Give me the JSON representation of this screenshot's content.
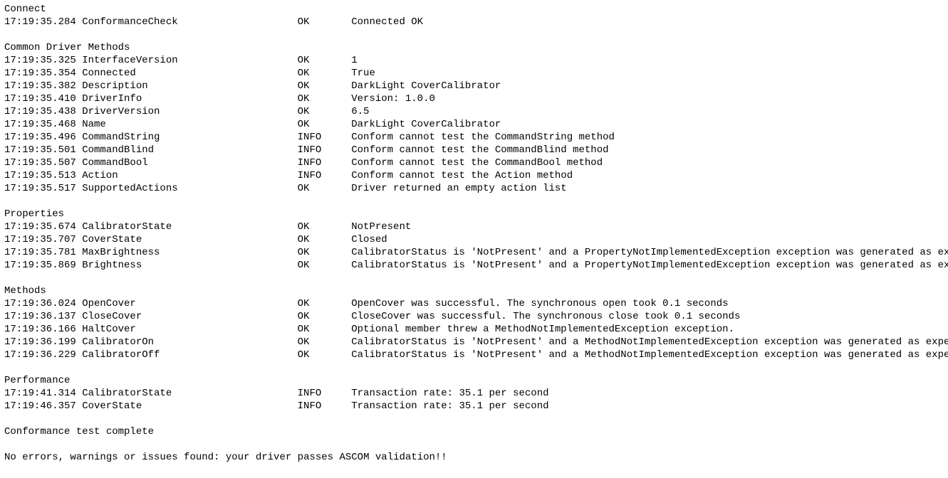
{
  "sections": [
    {
      "title": "Connect",
      "rows": [
        {
          "time": "17:19:35.284",
          "name": "ConformanceCheck",
          "status": "OK",
          "msg": "Connected OK"
        }
      ]
    },
    {
      "title": "Common Driver Methods",
      "rows": [
        {
          "time": "17:19:35.325",
          "name": "InterfaceVersion",
          "status": "OK",
          "msg": "1"
        },
        {
          "time": "17:19:35.354",
          "name": "Connected",
          "status": "OK",
          "msg": "True"
        },
        {
          "time": "17:19:35.382",
          "name": "Description",
          "status": "OK",
          "msg": "DarkLight CoverCalibrator"
        },
        {
          "time": "17:19:35.410",
          "name": "DriverInfo",
          "status": "OK",
          "msg": "Version: 1.0.0"
        },
        {
          "time": "17:19:35.438",
          "name": "DriverVersion",
          "status": "OK",
          "msg": "6.5"
        },
        {
          "time": "17:19:35.468",
          "name": "Name",
          "status": "OK",
          "msg": "DarkLight CoverCalibrator"
        },
        {
          "time": "17:19:35.496",
          "name": "CommandString",
          "status": "INFO",
          "msg": "Conform cannot test the CommandString method"
        },
        {
          "time": "17:19:35.501",
          "name": "CommandBlind",
          "status": "INFO",
          "msg": "Conform cannot test the CommandBlind method"
        },
        {
          "time": "17:19:35.507",
          "name": "CommandBool",
          "status": "INFO",
          "msg": "Conform cannot test the CommandBool method"
        },
        {
          "time": "17:19:35.513",
          "name": "Action",
          "status": "INFO",
          "msg": "Conform cannot test the Action method"
        },
        {
          "time": "17:19:35.517",
          "name": "SupportedActions",
          "status": "OK",
          "msg": "Driver returned an empty action list"
        }
      ]
    },
    {
      "title": "Properties",
      "rows": [
        {
          "time": "17:19:35.674",
          "name": "CalibratorState",
          "status": "OK",
          "msg": "NotPresent"
        },
        {
          "time": "17:19:35.707",
          "name": "CoverState",
          "status": "OK",
          "msg": "Closed"
        },
        {
          "time": "17:19:35.781",
          "name": "MaxBrightness",
          "status": "OK",
          "msg": "CalibratorStatus is 'NotPresent' and a PropertyNotImplementedException exception was generated as expected"
        },
        {
          "time": "17:19:35.869",
          "name": "Brightness",
          "status": "OK",
          "msg": "CalibratorStatus is 'NotPresent' and a PropertyNotImplementedException exception was generated as expected"
        }
      ]
    },
    {
      "title": "Methods",
      "rows": [
        {
          "time": "17:19:36.024",
          "name": "OpenCover",
          "status": "OK",
          "msg": "OpenCover was successful. The synchronous open took 0.1 seconds"
        },
        {
          "time": "17:19:36.137",
          "name": "CloseCover",
          "status": "OK",
          "msg": "CloseCover was successful. The synchronous close took 0.1 seconds"
        },
        {
          "time": "17:19:36.166",
          "name": "HaltCover",
          "status": "OK",
          "msg": "Optional member threw a MethodNotImplementedException exception."
        },
        {
          "time": "17:19:36.199",
          "name": "CalibratorOn",
          "status": "OK",
          "msg": "CalibratorStatus is 'NotPresent' and a MethodNotImplementedException exception was generated as expected"
        },
        {
          "time": "17:19:36.229",
          "name": "CalibratorOff",
          "status": "OK",
          "msg": "CalibratorStatus is 'NotPresent' and a MethodNotImplementedException exception was generated as expected"
        }
      ]
    },
    {
      "title": "Performance",
      "rows": [
        {
          "time": "17:19:41.314",
          "name": "CalibratorState",
          "status": "INFO",
          "msg": "Transaction rate: 35.1 per second"
        },
        {
          "time": "17:19:46.357",
          "name": "CoverState",
          "status": "INFO",
          "msg": "Transaction rate: 35.1 per second"
        }
      ]
    }
  ],
  "footer": {
    "complete": "Conformance test complete",
    "result": "No errors, warnings or issues found: your driver passes ASCOM validation!!"
  }
}
